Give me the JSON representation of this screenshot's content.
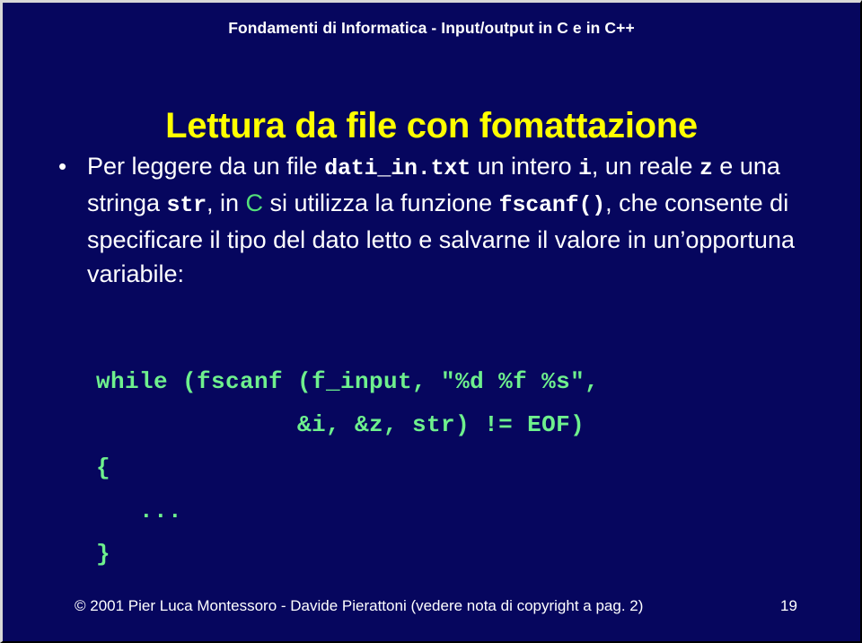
{
  "slide": {
    "header": "Fondamenti di Informatica - Input/output in C e in C++",
    "title": "Lettura da file con fomattazione",
    "bullet_marker": "•",
    "body_segments": [
      {
        "text": "Per leggere da un file ",
        "style": "plain"
      },
      {
        "text": "dati_in.txt",
        "style": "mono"
      },
      {
        "text": " un intero ",
        "style": "plain"
      },
      {
        "text": "i",
        "style": "mono"
      },
      {
        "text": ", un reale ",
        "style": "plain"
      },
      {
        "text": "z",
        "style": "mono"
      },
      {
        "text": " e una stringa ",
        "style": "plain"
      },
      {
        "text": "str",
        "style": "mono"
      },
      {
        "text": ", in ",
        "style": "plain"
      },
      {
        "text": "C",
        "style": "green"
      },
      {
        "text": " si utilizza la funzione ",
        "style": "plain"
      },
      {
        "text": "fscanf()",
        "style": "mono"
      },
      {
        "text": ", che consente di specificare il tipo del dato letto e salvarne il valore in un’opportuna variabile:",
        "style": "plain"
      }
    ],
    "code_lines": [
      "while (fscanf (f_input, \"%d %f %s\",",
      "              &i, &z, str) != EOF)",
      "{",
      "   ...",
      "}"
    ],
    "footer": "© 2001   Pier Luca Montessoro - Davide Pierattoni (vedere nota di copyright a pag. 2)",
    "page_number": "19",
    "colors": {
      "background": "#06065e",
      "title": "#ffff00",
      "text": "#ffffff",
      "code": "#6ef08d",
      "accent_green": "#54e07a"
    }
  }
}
